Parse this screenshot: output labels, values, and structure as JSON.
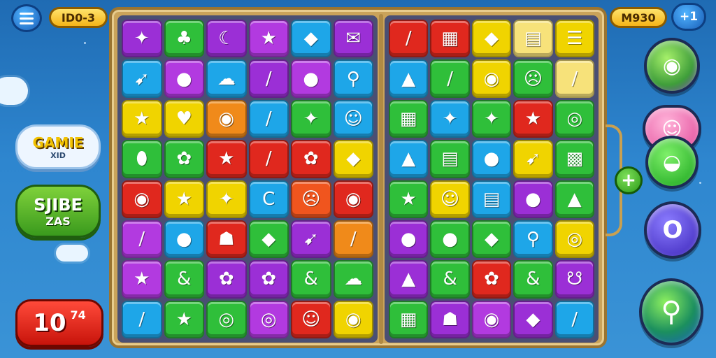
{
  "top_bar": {
    "level_label": "ID0-3",
    "score_label": "M930",
    "plus_label": "+1",
    "menu_icon": "hamburger-icon"
  },
  "left_panel": {
    "game_badge": {
      "title": "GAMIE",
      "subtitle": "XID"
    },
    "side_badge": {
      "title": "SJIBE",
      "subtitle": "ZAS"
    },
    "moves": {
      "value": "10",
      "suffix": "74"
    }
  },
  "board": {
    "left_grid": [
      [
        {
          "g": "✦",
          "c": "#9b2fd6"
        },
        {
          "g": "♣",
          "c": "#2fbf3a"
        },
        {
          "g": "☾",
          "c": "#9b2fd6"
        },
        {
          "g": "★",
          "c": "#b23ae0"
        },
        {
          "g": "◆",
          "c": "#1ea6e8"
        },
        {
          "g": "✉",
          "c": "#9b2fd6"
        }
      ],
      [
        {
          "g": "➹",
          "c": "#1ea6e8"
        },
        {
          "g": "●",
          "c": "#b23ae0"
        },
        {
          "g": "☁",
          "c": "#1ea6e8"
        },
        {
          "g": "/",
          "c": "#9b2fd6"
        },
        {
          "g": "●",
          "c": "#b23ae0"
        },
        {
          "g": "⚲",
          "c": "#1ea6e8"
        }
      ],
      [
        {
          "g": "★",
          "c": "#f0d400"
        },
        {
          "g": "♥",
          "c": "#f0d400"
        },
        {
          "g": "◉",
          "c": "#f08a1a"
        },
        {
          "g": "/",
          "c": "#1ea6e8"
        },
        {
          "g": "✦",
          "c": "#2fbf3a"
        },
        {
          "g": "☺",
          "c": "#1ea6e8"
        }
      ],
      [
        {
          "g": "⬮",
          "c": "#2fbf3a"
        },
        {
          "g": "✿",
          "c": "#2fbf3a"
        },
        {
          "g": "★",
          "c": "#e0281e"
        },
        {
          "g": "/",
          "c": "#e0281e"
        },
        {
          "g": "✿",
          "c": "#e0281e"
        },
        {
          "g": "◆",
          "c": "#f0d400"
        }
      ],
      [
        {
          "g": "◉",
          "c": "#e0281e"
        },
        {
          "g": "★",
          "c": "#f0d400"
        },
        {
          "g": "✦",
          "c": "#f0d400"
        },
        {
          "g": "C",
          "c": "#1ea6e8"
        },
        {
          "g": "☹",
          "c": "#f0551e"
        },
        {
          "g": "◉",
          "c": "#e0281e"
        }
      ],
      [
        {
          "g": "/",
          "c": "#b23ae0"
        },
        {
          "g": "●",
          "c": "#1ea6e8"
        },
        {
          "g": "☗",
          "c": "#e0281e"
        },
        {
          "g": "◆",
          "c": "#2fbf3a"
        },
        {
          "g": "➹",
          "c": "#9b2fd6"
        },
        {
          "g": "/",
          "c": "#f08a1a"
        }
      ],
      [
        {
          "g": "★",
          "c": "#b23ae0"
        },
        {
          "g": "&",
          "c": "#2fbf3a"
        },
        {
          "g": "✿",
          "c": "#9b2fd6"
        },
        {
          "g": "✿",
          "c": "#9b2fd6"
        },
        {
          "g": "&",
          "c": "#2fbf3a"
        },
        {
          "g": "☁",
          "c": "#2fbf3a"
        }
      ],
      [
        {
          "g": "/",
          "c": "#1ea6e8"
        },
        {
          "g": "★",
          "c": "#2fbf3a"
        },
        {
          "g": "◎",
          "c": "#2fbf3a"
        },
        {
          "g": "◎",
          "c": "#b23ae0"
        },
        {
          "g": "☺",
          "c": "#e0281e"
        },
        {
          "g": "◉",
          "c": "#f0d400"
        }
      ]
    ],
    "right_grid": [
      [
        {
          "g": "/",
          "c": "#e0281e"
        },
        {
          "g": "▦",
          "c": "#e0281e"
        },
        {
          "g": "◆",
          "c": "#f0d400"
        },
        {
          "g": "▤",
          "c": "#f7e27a"
        },
        {
          "g": "☰",
          "c": "#f0d400"
        }
      ],
      [
        {
          "g": "▲",
          "c": "#1ea6e8"
        },
        {
          "g": "/",
          "c": "#2fbf3a"
        },
        {
          "g": "◉",
          "c": "#f0d400"
        },
        {
          "g": "☹",
          "c": "#2fbf3a"
        },
        {
          "g": "/",
          "c": "#f7e27a"
        }
      ],
      [
        {
          "g": "▦",
          "c": "#2fbf3a"
        },
        {
          "g": "✦",
          "c": "#1ea6e8"
        },
        {
          "g": "✦",
          "c": "#2fbf3a"
        },
        {
          "g": "★",
          "c": "#e0281e"
        },
        {
          "g": "◎",
          "c": "#2fbf3a"
        }
      ],
      [
        {
          "g": "▲",
          "c": "#1ea6e8"
        },
        {
          "g": "▤",
          "c": "#2fbf3a"
        },
        {
          "g": "●",
          "c": "#1ea6e8"
        },
        {
          "g": "➹",
          "c": "#f0d400"
        },
        {
          "g": "▩",
          "c": "#2fbf3a"
        }
      ],
      [
        {
          "g": "★",
          "c": "#2fbf3a"
        },
        {
          "g": "☺",
          "c": "#f0d400"
        },
        {
          "g": "▤",
          "c": "#1ea6e8"
        },
        {
          "g": "●",
          "c": "#9b2fd6"
        },
        {
          "g": "▲",
          "c": "#2fbf3a"
        }
      ],
      [
        {
          "g": "●",
          "c": "#9b2fd6"
        },
        {
          "g": "●",
          "c": "#2fbf3a"
        },
        {
          "g": "◆",
          "c": "#2fbf3a"
        },
        {
          "g": "⚲",
          "c": "#1ea6e8"
        },
        {
          "g": "◎",
          "c": "#f0d400"
        }
      ],
      [
        {
          "g": "▲",
          "c": "#9b2fd6"
        },
        {
          "g": "&",
          "c": "#2fbf3a"
        },
        {
          "g": "✿",
          "c": "#e0281e"
        },
        {
          "g": "&",
          "c": "#2fbf3a"
        },
        {
          "g": "☋",
          "c": "#9b2fd6"
        }
      ],
      [
        {
          "g": "▦",
          "c": "#2fbf3a"
        },
        {
          "g": "☗",
          "c": "#9b2fd6"
        },
        {
          "g": "◉",
          "c": "#b23ae0"
        },
        {
          "g": "◆",
          "c": "#9b2fd6"
        },
        {
          "g": "/",
          "c": "#1ea6e8"
        }
      ]
    ]
  },
  "right_panel": {
    "add_label": "+",
    "bubbles": [
      {
        "glyph": "◉",
        "icon": "eye-bubble-icon"
      },
      {
        "glyph": "☺",
        "icon": "cat-bubble-icon"
      },
      {
        "glyph": "◒",
        "icon": "green-bubble-icon"
      },
      {
        "glyph": "O",
        "icon": "ring-bubble-icon"
      },
      {
        "glyph": "⚲",
        "icon": "key-bubble-icon"
      }
    ]
  }
}
